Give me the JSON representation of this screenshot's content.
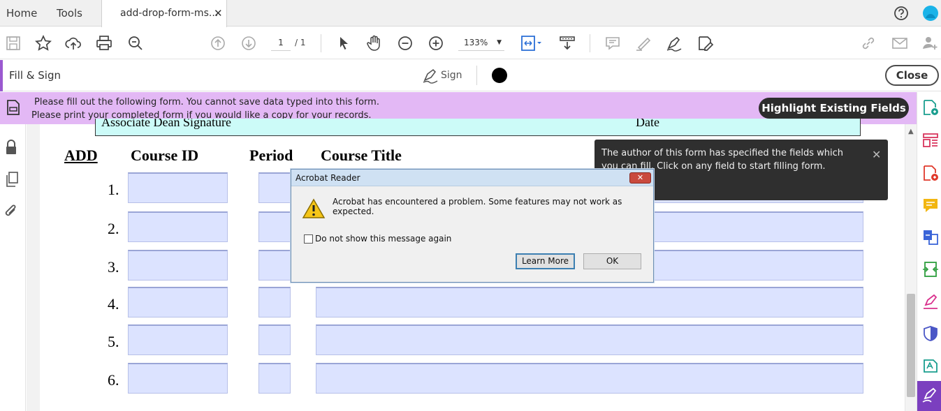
{
  "tabs": {
    "home": "Home",
    "tools": "Tools",
    "document": "add-drop-form-ms...",
    "close_glyph": "✕"
  },
  "toolbar": {
    "page_current": "1",
    "page_total": "/ 1",
    "zoom": "133%"
  },
  "fill_sign": {
    "title": "Fill & Sign",
    "sign_label": "Sign",
    "close_label": "Close"
  },
  "banner": {
    "line1": "Please fill out the following form. You cannot save data typed into this form.",
    "line2": "Please print your completed form if you would like a copy for your records.",
    "highlight_button": "Highlight Existing Fields"
  },
  "form": {
    "signature_left": "Associate Dean Signature",
    "signature_right": "Date",
    "headers": {
      "add": "ADD",
      "course_id": "Course ID",
      "period": "Period",
      "course_title": "Course Title"
    },
    "rows": [
      "1.",
      "2.",
      "3.",
      "4.",
      "5.",
      "6."
    ]
  },
  "tooltip": {
    "text": "The author of this form has specified the fields which you can fill. Click on any field to start filling form.",
    "close_glyph": "✕"
  },
  "dialog": {
    "title": "Acrobat Reader",
    "close_glyph": "✕",
    "message": "Acrobat has encountered a problem. Some features may not work as expected.",
    "checkbox_label": "Do not show this message again",
    "learn_more": "Learn More",
    "ok": "OK"
  },
  "colors": {
    "banner": "#e3b8f5",
    "accent": "#7b3fbf",
    "field": "#dce3ff",
    "signature_strip": "#ccfbf8"
  }
}
